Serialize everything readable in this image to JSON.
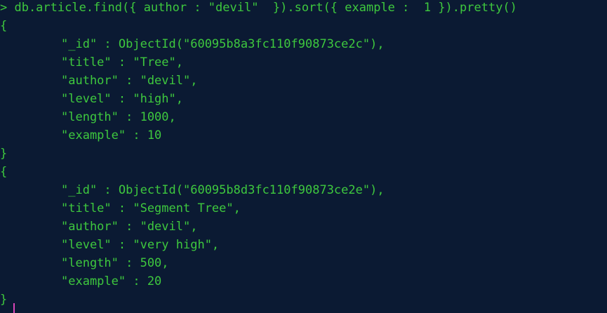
{
  "terminal": {
    "command": "> db.article.find({ author : \"devil\"  }).sort({ example :  1 }).pretty()",
    "documents": [
      {
        "open": "{",
        "fields": [
          "\"_id\" : ObjectId(\"60095b8a3fc110f90873ce2c\"),",
          "\"title\" : \"Tree\",",
          "\"author\" : \"devil\",",
          "\"level\" : \"high\",",
          "\"length\" : 1000,",
          "\"example\" : 10"
        ],
        "close": "}"
      },
      {
        "open": "{",
        "fields": [
          "\"_id\" : ObjectId(\"60095b8d3fc110f90873ce2e\"),",
          "\"title\" : \"Segment Tree\",",
          "\"author\" : \"devil\",",
          "\"level\" : \"very high\",",
          "\"length\" : 500,",
          "\"example\" : 20"
        ],
        "close": "}"
      }
    ],
    "colors": {
      "background": "#0b1a33",
      "text": "#3ec83e",
      "cursor": "#d946b8"
    }
  }
}
